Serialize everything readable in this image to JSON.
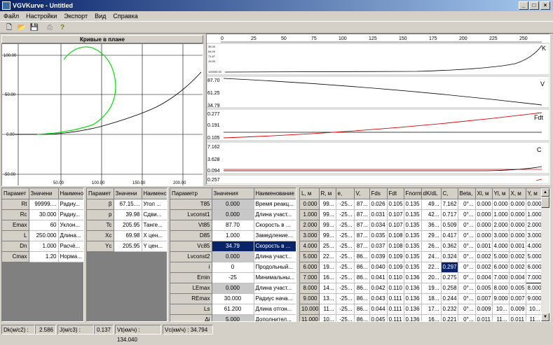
{
  "window": {
    "title": "VGVKurve - Untitled"
  },
  "menu": [
    "Файл",
    "Настройки",
    "Экспорт",
    "Вид",
    "Справка"
  ],
  "plan": {
    "header": "Кривые в плане",
    "yticks": [
      "100.00",
      "50.00",
      "0.00",
      "-50.00"
    ],
    "xticks": [
      "50.00",
      "100.00",
      "150.00",
      "200.00"
    ]
  },
  "profile": {
    "xticks": [
      "0",
      "25",
      "50",
      "75",
      "100",
      "125",
      "150",
      "175",
      "200",
      "225",
      "250"
    ],
    "k": {
      "name": "K",
      "ticks": [
        "36.00",
        "54.00",
        "71.67",
        "19.00",
        "100000.00"
      ]
    },
    "v": {
      "name": "V",
      "ticks": [
        "87.70",
        "61.25",
        "34.79"
      ]
    },
    "fdt": {
      "name": "Fdt",
      "ticks": [
        "0.277",
        "0.191",
        "0.105"
      ]
    },
    "c": {
      "name": "C",
      "ticks": [
        "7.162",
        "3.628",
        "0.094"
      ]
    },
    "extra": {
      "ticks": [
        "0.257"
      ]
    }
  },
  "table1": {
    "headers": [
      "Парамет",
      "Значени",
      "Наимено"
    ],
    "rows": [
      [
        "Rt",
        "99999....",
        "Радиу..."
      ],
      [
        "Rc",
        "30.000",
        "Радиу..."
      ],
      [
        "Emax",
        "60",
        "Уклон..."
      ],
      [
        "L",
        "250.000",
        "Длина..."
      ],
      [
        "Dn",
        "1.000",
        "Расчё..."
      ],
      [
        "Cmax",
        "1.20",
        "Норма..."
      ]
    ]
  },
  "table2": {
    "headers": [
      "Парамет",
      "Значени",
      "Наименс"
    ],
    "rows": [
      [
        "β",
        "67.15....",
        "Угол ..."
      ],
      [
        "p",
        "39.98",
        "Сдви..."
      ],
      [
        "Tc",
        "205.95",
        "Танге..."
      ],
      [
        "Xc",
        "69.98",
        "X цен..."
      ],
      [
        "Yc",
        "205.95",
        "Y цен..."
      ]
    ]
  },
  "table3": {
    "headers": [
      "Параметр",
      "Значения",
      "Наименование"
    ],
    "rows": [
      [
        "T85",
        "0.000",
        "Время реакц..."
      ],
      [
        "Lvconst1",
        "0.000",
        "Длина участ..."
      ],
      [
        "Vt85",
        "87.70",
        "Скорость в ..."
      ],
      [
        "D85",
        "1.000",
        "Замедление..."
      ],
      [
        "Vc85",
        "34.79",
        "Скорость в ..."
      ],
      [
        "Lvconst2",
        "0.000",
        "Длина участ..."
      ],
      [
        "i",
        "0",
        "Продольный..."
      ],
      [
        "Emin",
        "-25",
        "Минимальны..."
      ],
      [
        "LEmax",
        "0.000",
        "Длина участ..."
      ],
      [
        "REmax",
        "30.000",
        "Радиус нача..."
      ],
      [
        "Ls",
        "61.200",
        "Длина отгон..."
      ],
      [
        "Δi",
        "5.000",
        "Дополнител..."
      ]
    ]
  },
  "table4": {
    "headers": [
      "L, м",
      "R, м",
      "e,",
      "V,",
      "Fds",
      "Fdt",
      "Fnorm",
      "dK/dL",
      "C,",
      "Beta,",
      "Xl, м",
      "Yl, м",
      "X, м",
      "Y, м"
    ],
    "rows": [
      [
        "0.000",
        "99...",
        "-25...",
        "87...",
        "0.026",
        "0.105",
        "0.135",
        "49...",
        "7.162",
        "0°...",
        "0.000",
        "0.000",
        "0.000",
        "0.000"
      ],
      [
        "1.000",
        "99...",
        "-25...",
        "87...",
        "0.031",
        "0.107",
        "0.135",
        "42...",
        "0.717",
        "0°...",
        "0.000",
        "1.000",
        "0.000",
        "1.000"
      ],
      [
        "2.000",
        "99...",
        "-25...",
        "87...",
        "0.034",
        "0.107",
        "0.135",
        "36...",
        "0.509",
        "0°...",
        "0.000",
        "2.000",
        "0.000",
        "2.000"
      ],
      [
        "3.000",
        "99...",
        "-25...",
        "87...",
        "0.035",
        "0.108",
        "0.135",
        "29...",
        "0.417",
        "0°...",
        "0.000",
        "3.000",
        "0.000",
        "3.000"
      ],
      [
        "4.000",
        "25...",
        "-25...",
        "87...",
        "0.037",
        "0.108",
        "0.135",
        "26...",
        "0.362",
        "0°...",
        "0.001",
        "4.000",
        "0.001",
        "4.000"
      ],
      [
        "5.000",
        "22...",
        "-25...",
        "86...",
        "0.039",
        "0.109",
        "0.135",
        "24...",
        "0.324",
        "0°...",
        "0.002",
        "5.000",
        "0.002",
        "5.000"
      ],
      [
        "6.000",
        "19...",
        "-25...",
        "86...",
        "0.040",
        "0.109",
        "0.135",
        "22...",
        "0.297",
        "0°...",
        "0.002",
        "6.000",
        "0.002",
        "6.000"
      ],
      [
        "7.000",
        "16...",
        "-25...",
        "86...",
        "0.041",
        "0.110",
        "0.136",
        "20...",
        "0.275",
        "0°...",
        "0.004",
        "7.000",
        "0.004",
        "7.000"
      ],
      [
        "8.000",
        "14...",
        "-25...",
        "86...",
        "0.042",
        "0.110",
        "0.136",
        "19...",
        "0.258",
        "0°...",
        "0.005",
        "8.000",
        "0.005",
        "8.000"
      ],
      [
        "9.000",
        "13...",
        "-25...",
        "86...",
        "0.043",
        "0.111",
        "0.136",
        "18...",
        "0.244",
        "0°...",
        "0.007",
        "9.000",
        "0.007",
        "9.000"
      ],
      [
        "10.000",
        "11...",
        "-25...",
        "86...",
        "0.044",
        "0.111",
        "0.136",
        "17...",
        "0.232",
        "0°...",
        "0.009",
        "10...",
        "0.009",
        "10..."
      ],
      [
        "11.000",
        "10...",
        "-25...",
        "86...",
        "0.045",
        "0.111",
        "0.136",
        "16...",
        "0.221",
        "0°...",
        "0.011",
        "11...",
        "0.011",
        "11..."
      ]
    ]
  },
  "status": {
    "dk": "Dk(м/с2) :",
    "dk_val": "2.586",
    "j": "J(м/с3) :",
    "j_val": "0.137",
    "vt": "Vt(км/ч) : 134.040",
    "vc": "Vc(км/ч) :  34.794"
  }
}
